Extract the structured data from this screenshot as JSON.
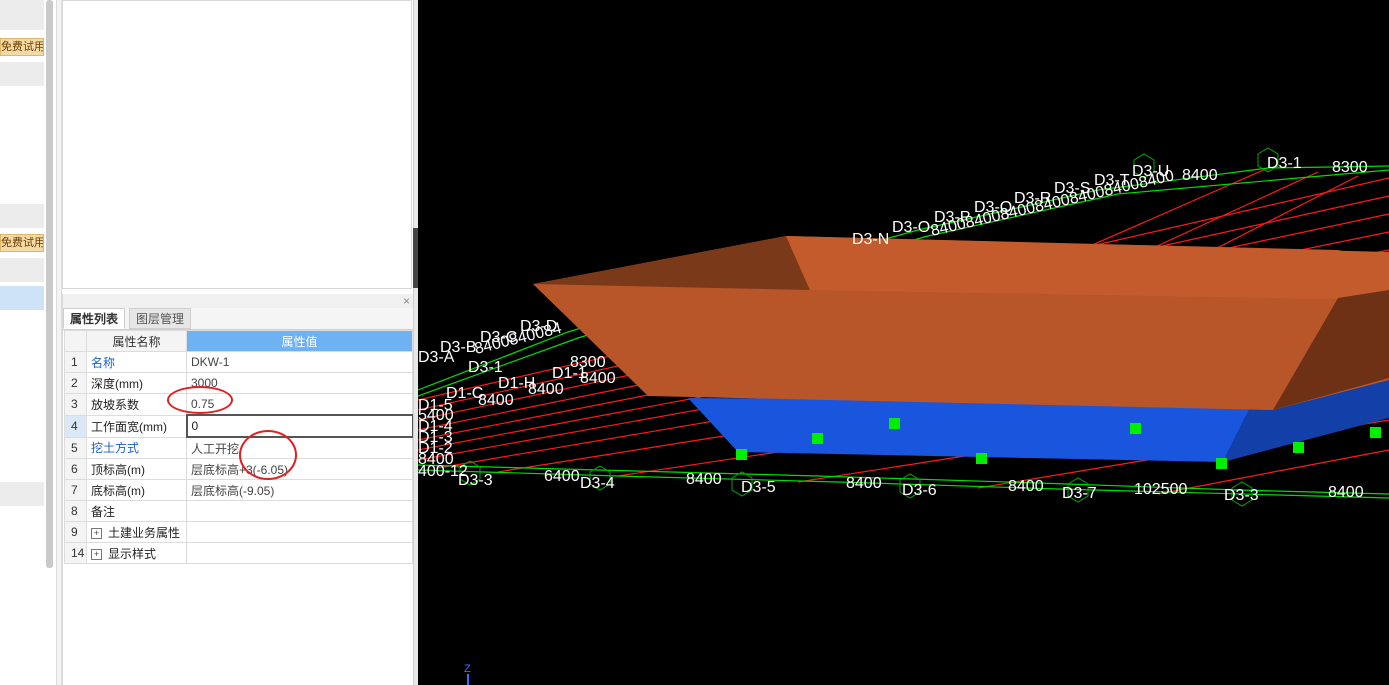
{
  "left_sidebar": {
    "trial_buttons": [
      "免费试用",
      "免费试用"
    ]
  },
  "properties": {
    "tabs": [
      "属性列表",
      "图层管理"
    ],
    "headers": [
      "属性名称",
      "属性值"
    ],
    "close_symbol": "×",
    "rows": [
      {
        "num": "1",
        "name": "名称",
        "value": "DKW-1"
      },
      {
        "num": "2",
        "name": "深度(mm)",
        "value": "3000"
      },
      {
        "num": "3",
        "name": "放坡系数",
        "value": "0.75"
      },
      {
        "num": "4",
        "name": "工作面宽(mm)",
        "value": "0"
      },
      {
        "num": "5",
        "name": "挖土方式",
        "value": "人工开挖"
      },
      {
        "num": "6",
        "name": "顶标高(m)",
        "value": "层底标高+3(-6.05)"
      },
      {
        "num": "7",
        "name": "底标高(m)",
        "value": "层底标高(-9.05)"
      },
      {
        "num": "8",
        "name": "备注",
        "value": ""
      },
      {
        "num": "9",
        "name": "土建业务属性",
        "value": "",
        "expand": "+"
      },
      {
        "num": "14",
        "name": "显示样式",
        "value": "",
        "expand": "+"
      }
    ]
  },
  "viewport": {
    "colors": {
      "background": "#000000",
      "grid": "#ff0000",
      "axis_line": "#00ff00",
      "pit_top_face": "#c0592a",
      "pit_slope": "#a04a22",
      "pit_bottom": "#1e5be0",
      "grip": "#00e000",
      "label": "#ffffff"
    },
    "axis_indicator": "Z",
    "bottom_labels": [
      "D3-3",
      "6400",
      "D3-4",
      "8400",
      "D3-5",
      "8400",
      "D3-6",
      "8400",
      "D3-7",
      "102500",
      "D3-3",
      "8400"
    ],
    "top_labels": [
      "D3-U",
      "8400",
      "D3-1",
      "8300",
      "D3-T",
      "D3-S",
      "D3-R",
      "D3-Q",
      "D3-P",
      "D3-O",
      "D3-N",
      "8400840084008400840084008400"
    ],
    "left_labels": [
      "D3-A",
      "D3-B",
      "D3-C",
      "D3-D",
      "8400840084",
      "D3-1",
      "8300",
      "D1-1",
      "D1-H",
      "8400",
      "D1-C",
      "8400",
      "8400",
      "D1-5",
      "5400",
      "D1-4",
      "D1-3",
      "D1-2",
      "8400",
      "400-12"
    ]
  }
}
